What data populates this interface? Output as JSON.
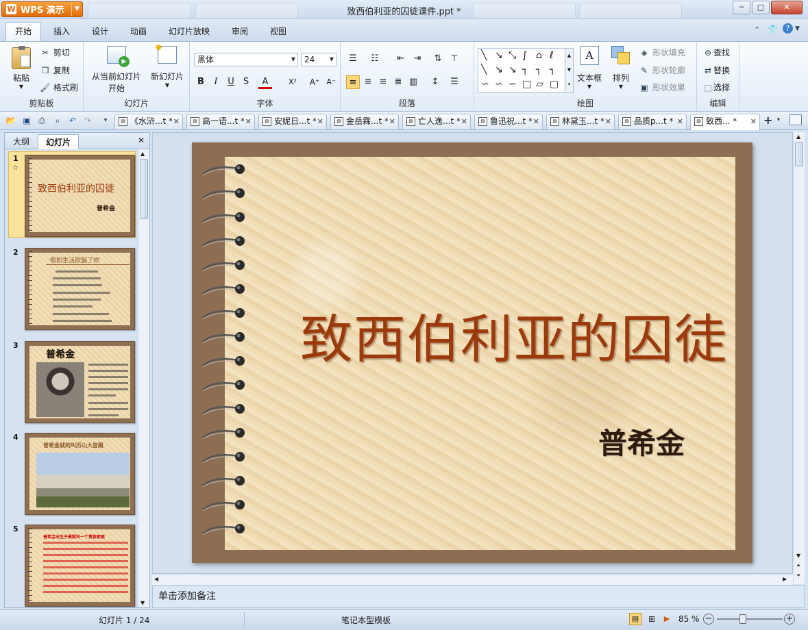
{
  "app": {
    "name": "WPS 演示",
    "window_title": "致西伯利亚的囚徒课件.ppt *"
  },
  "window_buttons": {
    "minimize": "─",
    "maximize": "□",
    "close": "✕"
  },
  "menu": [
    "开始",
    "插入",
    "设计",
    "动画",
    "幻灯片放映",
    "审阅",
    "视图"
  ],
  "ribbon": {
    "clipboard": {
      "group": "剪贴板",
      "paste": "粘贴",
      "cut": "剪切",
      "copy": "复制",
      "format_painter": "格式刷"
    },
    "slides": {
      "group": "幻灯片",
      "from_current_line1": "从当前幻灯片",
      "from_current_line2": "开始",
      "new_slide": "新幻灯片"
    },
    "font": {
      "group": "字体",
      "font_name": "黑体",
      "font_size": "24",
      "bold": "B",
      "italic": "I",
      "underline": "U",
      "strike": "S",
      "color": "A",
      "superscript": "X²",
      "grow": "A⁺",
      "shrink": "A⁻"
    },
    "paragraph": {
      "group": "段落"
    },
    "drawing": {
      "group": "绘图",
      "textbox": "文本框",
      "arrange": "排列",
      "shape_fill": "形状填充",
      "shape_outline": "形状轮廓",
      "shape_effect": "形状效果"
    },
    "editing": {
      "group": "编辑",
      "find": "查找",
      "replace": "替换",
      "select": "选择"
    }
  },
  "doc_tabs": [
    {
      "label": "《水浒...t *",
      "active": false
    },
    {
      "label": "高一语...t *",
      "active": false
    },
    {
      "label": "安妮日...t *",
      "active": false
    },
    {
      "label": "金岳霖...t *",
      "active": false
    },
    {
      "label": "亡人逸...t *",
      "active": false
    },
    {
      "label": "鲁迅祝...t *",
      "active": false
    },
    {
      "label": "林黛玉...t *",
      "active": false
    },
    {
      "label": "品质p...t *",
      "active": false
    },
    {
      "label": "致西... *",
      "active": true
    }
  ],
  "panel": {
    "tab_outline": "大纲",
    "tab_slides": "幻灯片",
    "close": "✕"
  },
  "thumbnails": [
    {
      "num": "1",
      "title": "致西伯利亚的囚徒",
      "subtitle": "普希金"
    },
    {
      "num": "2",
      "title": "假如生活欺骗了你"
    },
    {
      "num": "3",
      "title": "普希金"
    },
    {
      "num": "4",
      "title": "普希金就的叫历山大宫殿"
    },
    {
      "num": "5",
      "title": "普希金出生于莫斯科一个贵族家庭"
    }
  ],
  "slide": {
    "title": "致西伯利亚的囚徒",
    "author": "普希金"
  },
  "notes_placeholder": "单击添加备注",
  "status": {
    "slide_counter": "幻灯片 1 / 24",
    "template": "笔记本型模板",
    "zoom": "85 %"
  },
  "colors": {
    "accent_orange": "#e26c0a",
    "slide_frame": "#8e6e52",
    "title_color": "#9c3a0c"
  }
}
